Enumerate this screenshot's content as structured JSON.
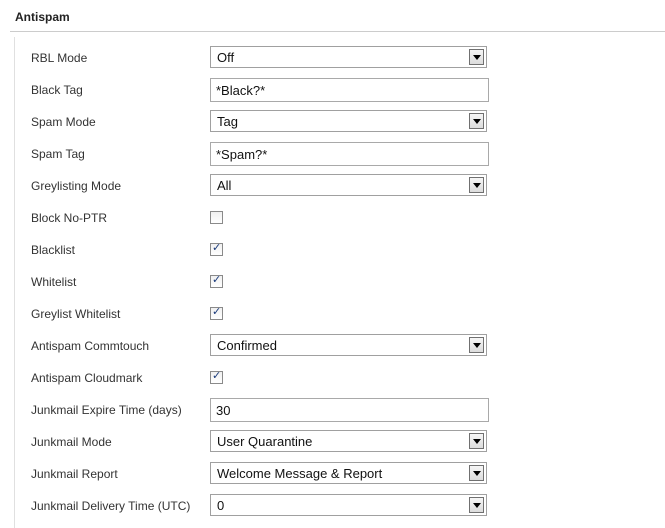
{
  "section": {
    "title": "Antispam"
  },
  "fields": {
    "rbl_mode": {
      "label": "RBL Mode",
      "value": "Off"
    },
    "black_tag": {
      "label": "Black Tag",
      "value": "*Black?*"
    },
    "spam_mode": {
      "label": "Spam Mode",
      "value": "Tag"
    },
    "spam_tag": {
      "label": "Spam Tag",
      "value": "*Spam?*"
    },
    "greylisting_mode": {
      "label": "Greylisting Mode",
      "value": "All"
    },
    "block_no_ptr": {
      "label": "Block No-PTR",
      "checked": false
    },
    "blacklist": {
      "label": "Blacklist",
      "checked": true
    },
    "whitelist": {
      "label": "Whitelist",
      "checked": true
    },
    "greylist_whitelist": {
      "label": "Greylist Whitelist",
      "checked": true
    },
    "antispam_commtouch": {
      "label": "Antispam Commtouch",
      "value": "Confirmed"
    },
    "antispam_cloudmark": {
      "label": "Antispam Cloudmark",
      "checked": true
    },
    "junkmail_expire_time": {
      "label": "Junkmail Expire Time (days)",
      "value": "30"
    },
    "junkmail_mode": {
      "label": "Junkmail Mode",
      "value": "User Quarantine"
    },
    "junkmail_report": {
      "label": "Junkmail Report",
      "value": "Welcome Message & Report"
    },
    "junkmail_delivery_time": {
      "label": "Junkmail Delivery Time (UTC)",
      "value": "0"
    }
  }
}
